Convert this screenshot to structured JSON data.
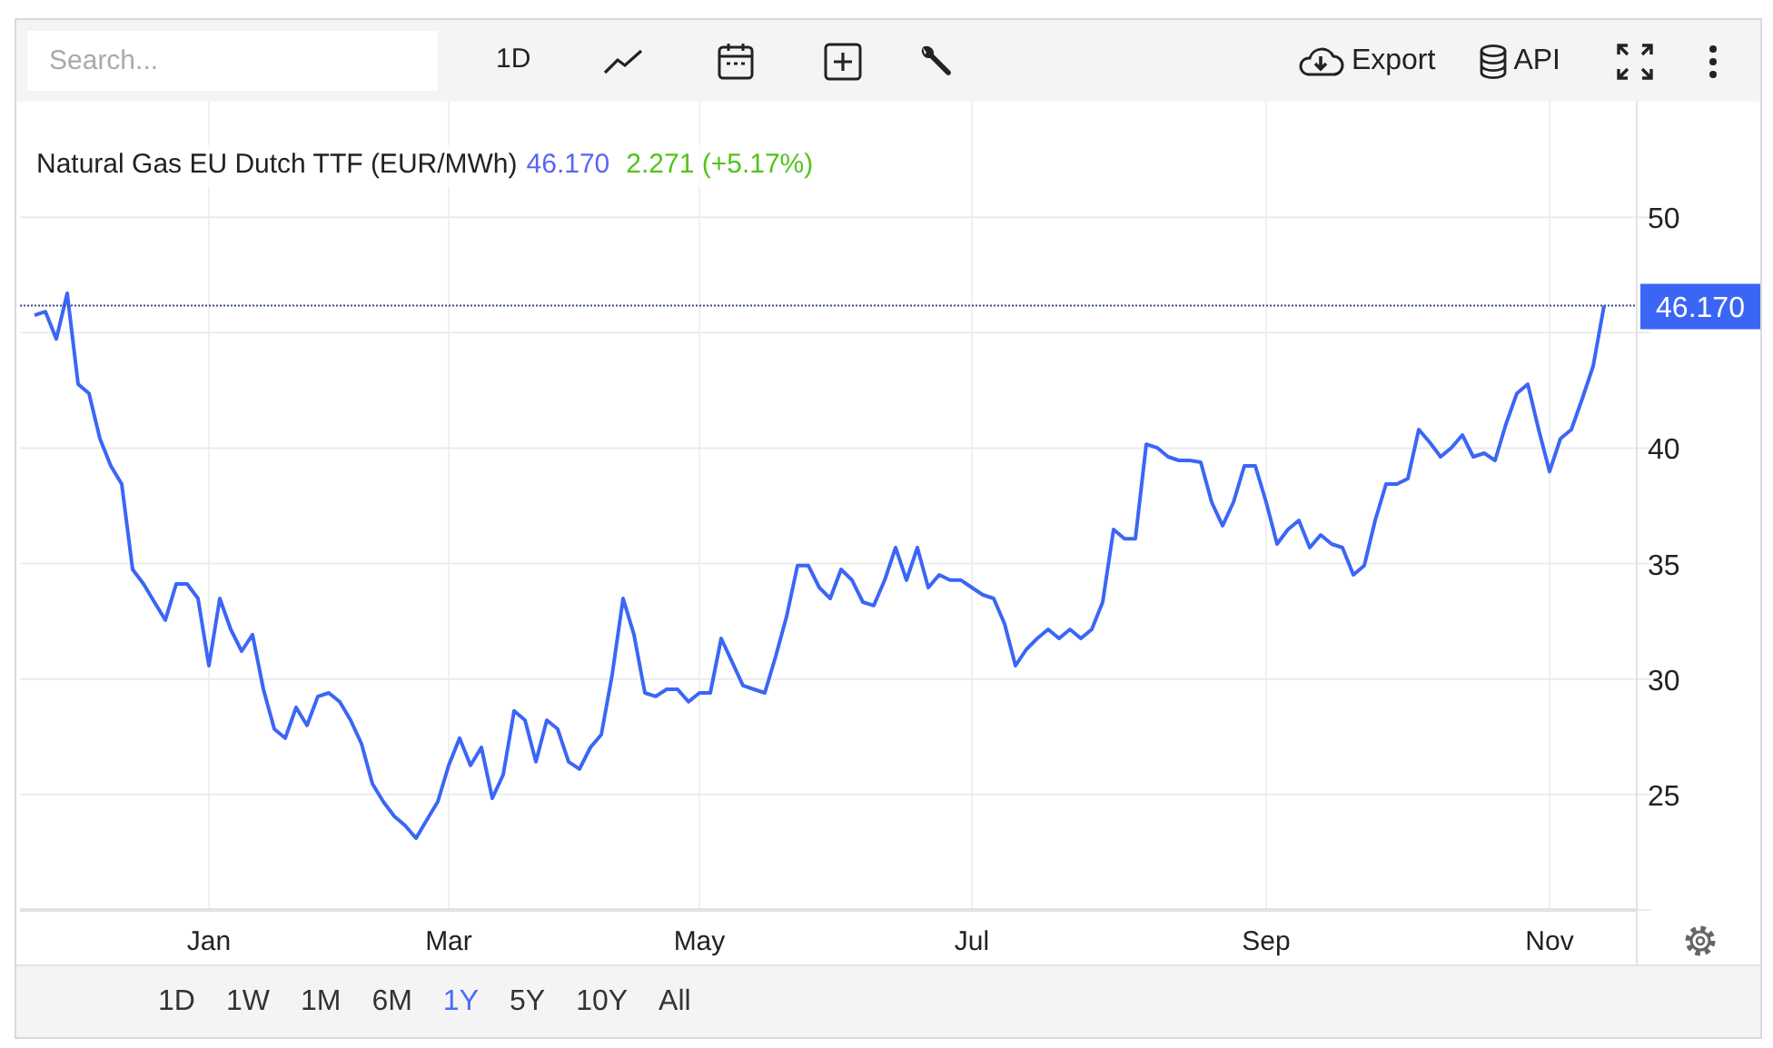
{
  "toolbar": {
    "search": {
      "placeholder": "Search..."
    },
    "interval": "1D",
    "export": "Export",
    "api": "API"
  },
  "header": {
    "price": "46.170",
    "change": "2.271 (+5.17%)"
  },
  "chart": {
    "chart_data": {
      "type": "line",
      "grid": true,
      "ref_lines": [
        {
          "axis": "y",
          "value": 46.17,
          "label": "46.170",
          "color": "#3b4a8a"
        }
      ],
      "categories": [
        null,
        null,
        null,
        null,
        null,
        null,
        null,
        null,
        null,
        null,
        null,
        null,
        null,
        null,
        null,
        null,
        "Jan",
        null,
        null,
        null,
        null,
        null,
        null,
        null,
        null,
        null,
        null,
        null,
        null,
        null,
        null,
        null,
        null,
        null,
        null,
        null,
        null,
        null,
        "Mar",
        null,
        null,
        null,
        null,
        null,
        null,
        null,
        null,
        null,
        null,
        null,
        null,
        null,
        null,
        null,
        null,
        null,
        null,
        null,
        null,
        null,
        null,
        "May",
        null,
        null,
        null,
        null,
        null,
        null,
        null,
        null,
        null,
        null,
        null,
        null,
        null,
        null,
        null,
        null,
        null,
        null,
        null,
        null,
        null,
        null,
        null,
        null,
        "Jul",
        null,
        null,
        null,
        null,
        null,
        null,
        null,
        null,
        null,
        null,
        null,
        null,
        null,
        null,
        null,
        null,
        null,
        null,
        null,
        null,
        null,
        null,
        null,
        null,
        null,
        null,
        "Sep",
        null,
        null,
        null,
        null,
        null,
        null,
        null,
        null,
        null,
        null,
        null,
        null,
        null,
        null,
        null,
        null,
        null,
        null,
        null,
        null,
        null,
        null,
        null,
        null,
        null,
        "Nov",
        null,
        null,
        null,
        null,
        null
      ],
      "ylim": [
        20,
        55
      ],
      "yticks": [
        25,
        30,
        35,
        40,
        50
      ],
      "series": [
        {
          "name": "Natural Gas EU Dutch TTF (EUR/MWh)",
          "color": "#3b66f5",
          "values": [
            45.75,
            45.91,
            44.73,
            46.7,
            42.77,
            42.37,
            40.41,
            39.23,
            38.44,
            34.75,
            34.12,
            33.33,
            32.55,
            34.12,
            34.12,
            33.49,
            30.58,
            33.49,
            32.15,
            31.21,
            31.92,
            29.56,
            27.83,
            27.44,
            28.77,
            27.99,
            29.25,
            29.4,
            29.01,
            28.22,
            27.2,
            25.47,
            24.69,
            24.06,
            23.66,
            23.11,
            23.9,
            24.69,
            26.26,
            27.44,
            26.26,
            27.04,
            24.84,
            25.86,
            28.62,
            28.22,
            26.42,
            28.22,
            27.83,
            26.42,
            26.1,
            27.04,
            27.59,
            30.19,
            33.49,
            31.92,
            29.4,
            29.25,
            29.56,
            29.56,
            29.01,
            29.4,
            29.4,
            31.76,
            30.74,
            29.72,
            29.56,
            29.4,
            30.98,
            32.71,
            34.91,
            34.91,
            33.96,
            33.49,
            34.75,
            34.28,
            33.33,
            33.18,
            34.28,
            35.69,
            34.28,
            35.69,
            33.96,
            34.51,
            34.28,
            34.28,
            33.96,
            33.65,
            33.49,
            32.39,
            30.58,
            31.29,
            31.76,
            32.15,
            31.76,
            32.15,
            31.76,
            32.15,
            33.33,
            36.48,
            36.08,
            36.08,
            40.17,
            40.02,
            39.62,
            39.47,
            39.47,
            39.39,
            37.66,
            36.64,
            37.66,
            39.23,
            39.23,
            37.66,
            35.85,
            36.48,
            36.87,
            35.69,
            36.24,
            35.85,
            35.69,
            34.51,
            34.91,
            36.87,
            38.44,
            38.44,
            38.68,
            40.8,
            40.25,
            39.62,
            40.02,
            40.57,
            39.62,
            39.78,
            39.47,
            41.04,
            42.37,
            42.77,
            40.8,
            38.99,
            40.41,
            40.8,
            42.14,
            43.55,
            46.17
          ]
        }
      ]
    }
  },
  "ranges": [
    {
      "label": "1D",
      "selected": false
    },
    {
      "label": "1W",
      "selected": false
    },
    {
      "label": "1M",
      "selected": false
    },
    {
      "label": "6M",
      "selected": false
    },
    {
      "label": "1Y",
      "selected": true
    },
    {
      "label": "5Y",
      "selected": false
    },
    {
      "label": "10Y",
      "selected": false
    },
    {
      "label": "All",
      "selected": false
    }
  ]
}
